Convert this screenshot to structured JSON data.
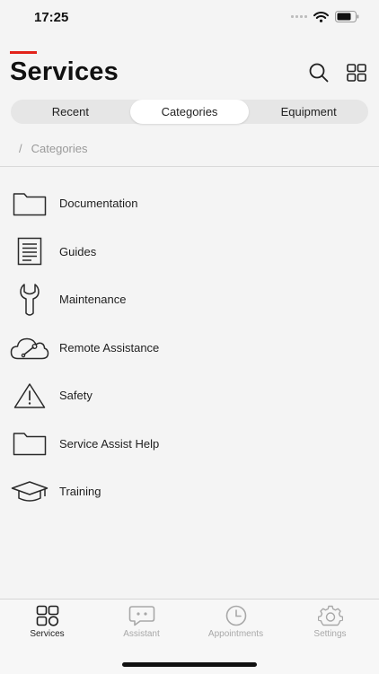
{
  "status_bar": {
    "time": "17:25"
  },
  "header": {
    "title": "Services",
    "accent_color": "#e2231a"
  },
  "segments": [
    {
      "label": "Recent",
      "active": false
    },
    {
      "label": "Categories",
      "active": true
    },
    {
      "label": "Equipment",
      "active": false
    }
  ],
  "breadcrumb": {
    "separator": "/",
    "current": "Categories"
  },
  "categories": [
    {
      "label": "Documentation",
      "icon": "folder-icon"
    },
    {
      "label": "Guides",
      "icon": "document-icon"
    },
    {
      "label": "Maintenance",
      "icon": "wrench-icon"
    },
    {
      "label": "Remote Assistance",
      "icon": "cloud-wrench-icon"
    },
    {
      "label": "Safety",
      "icon": "warning-icon"
    },
    {
      "label": "Service Assist Help",
      "icon": "folder-icon"
    },
    {
      "label": "Training",
      "icon": "graduation-cap-icon"
    }
  ],
  "tabbar": {
    "tabs": [
      {
        "label": "Services",
        "icon": "grid-icon",
        "active": true
      },
      {
        "label": "Assistant",
        "icon": "chat-bubble-icon",
        "active": false
      },
      {
        "label": "Appointments",
        "icon": "clock-icon",
        "active": false
      },
      {
        "label": "Settings",
        "icon": "gear-icon",
        "active": false
      }
    ]
  }
}
